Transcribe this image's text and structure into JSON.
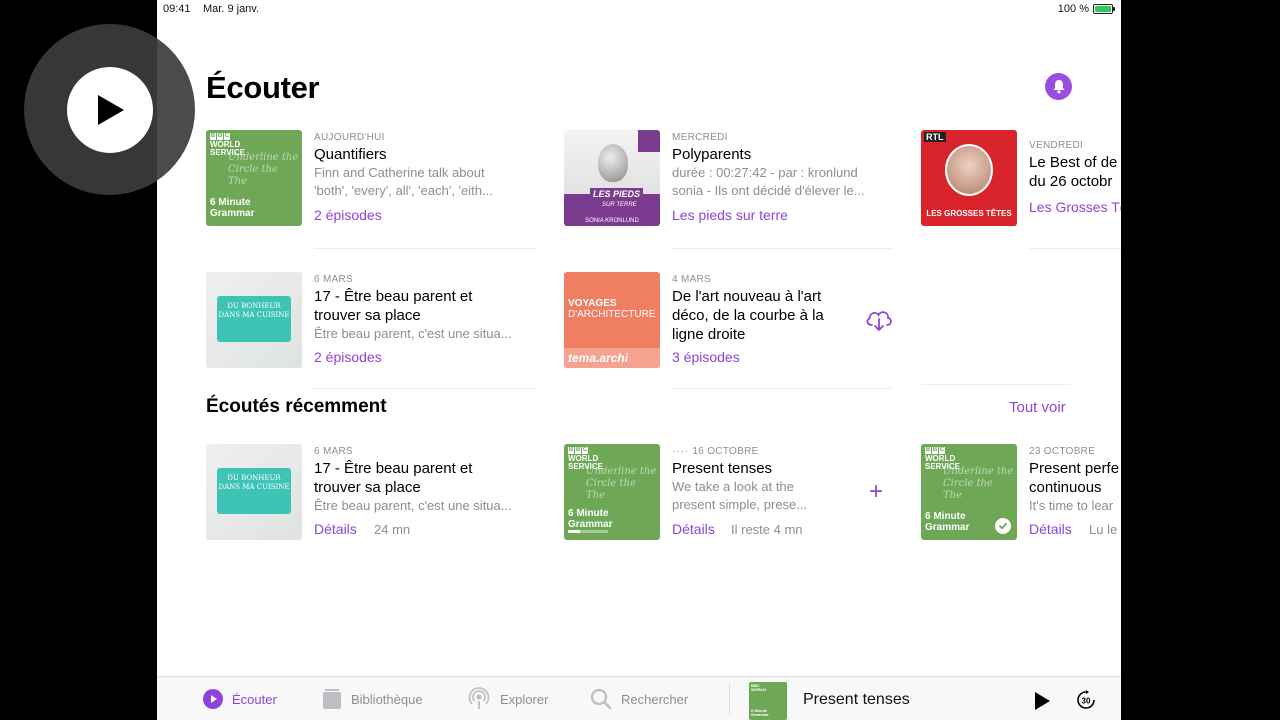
{
  "status": {
    "time": "09:41",
    "date": "Mar. 9 janv.",
    "battery": "100 %"
  },
  "page_title": "Écouter",
  "up_next": [
    {
      "date": "AUJOURD'HUI",
      "title": "Quantifiers",
      "desc": [
        "Finn and Catherine talk about",
        "'both', 'every', all', 'each', 'eith..."
      ],
      "link": "2 épisodes",
      "art": "bbc"
    },
    {
      "date": "MERCREDI",
      "title": "Polyparents",
      "desc": [
        "durée : 00:27:42 - par : kronlund",
        "sonia - Ils ont décidé d'élever le..."
      ],
      "link": "Les pieds sur terre",
      "art": "pieds"
    },
    {
      "date": "VENDREDI",
      "title": "Le Best of de",
      "title2": "du 26 octobr",
      "link": "Les Grosses Tê",
      "art": "rtl"
    },
    {
      "date": "6 MARS",
      "title": "17 - Être beau parent et",
      "title2": "trouver sa place",
      "desc": [
        "Être beau parent, c'est une situa..."
      ],
      "link": "2 épisodes",
      "art": "cuisine"
    },
    {
      "date": "4 MARS",
      "title": "De l'art nouveau à l'art",
      "title2": "déco, de la courbe à la",
      "title3": "ligne droite",
      "link": "3 épisodes",
      "art": "voyages"
    }
  ],
  "recent_section": {
    "title": "Écoutés récemment",
    "see_all": "Tout voir"
  },
  "recent": [
    {
      "date": "6 MARS",
      "title": "17 - Être beau parent et",
      "title2": "trouver sa place",
      "desc": [
        "Être beau parent, c'est une situa..."
      ],
      "link": "Détails",
      "sub": "24 mn"
    },
    {
      "date": "16 OCTOBRE",
      "title": "Present tenses",
      "desc": [
        "We take a look at the",
        "present simple, prese..."
      ],
      "link": "Détails",
      "sub": "Il reste 4 mn",
      "progress": 0.3
    },
    {
      "date": "23 OCTOBRE",
      "title": "Present perfe",
      "title2": "continuous",
      "desc": [
        "It's time to lear"
      ],
      "link": "Détails",
      "sub": "Lu le"
    }
  ],
  "art_text": {
    "bbc_logo": [
      "B",
      "B",
      "C"
    ],
    "bbc_service": "WORLD",
    "bbc_service2": "SERVICE",
    "bbc_scribble": [
      "Underline the",
      "Circle the",
      "The"
    ],
    "bbc_name": "6 Minute",
    "bbc_name2": "Grammar",
    "pieds_label": "LES PIEDS",
    "pieds_sub": "SUR TERRE",
    "pieds_author": "SONIA KRONLUND",
    "rtl_logo": "RTL",
    "rtl_title": "LES GROSSES TÊTES",
    "cuisine": "DU BONHEUR DANS MA CUISINE",
    "voyages1": "VOYAGES",
    "voyages2": "D'ARCHITECTURE",
    "voyages_brand": "tema.archi"
  },
  "tabs": [
    {
      "label": "Écouter",
      "icon": "play-circle-icon",
      "active": true
    },
    {
      "label": "Bibliothèque",
      "icon": "library-icon"
    },
    {
      "label": "Explorer",
      "icon": "podcast-icon"
    },
    {
      "label": "Rechercher",
      "icon": "search-icon"
    }
  ],
  "mini_player": {
    "title": "Present tenses",
    "skip": "30"
  },
  "colors": {
    "accent": "#8e44d9",
    "bbc_green": "#6ea857"
  }
}
